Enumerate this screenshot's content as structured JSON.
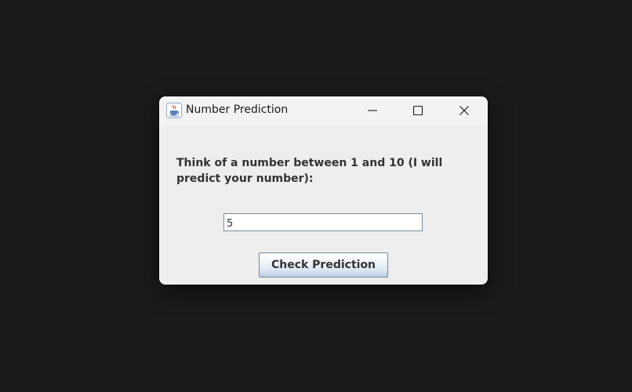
{
  "window": {
    "title": "Number Prediction",
    "icon": "java-cup-icon",
    "controls": [
      "minimize-icon",
      "maximize-icon",
      "close-icon"
    ]
  },
  "form": {
    "prompt": "Think of a number between 1 and 10 (I will predict your number):",
    "input_value": "5",
    "button_label": "Check Prediction"
  },
  "colors": {
    "desktop": "#1a1a1a",
    "window_bg": "#eeeeee",
    "titlebar_bg": "#f3f3f3",
    "text": "#333333",
    "button_gradient_bottom": "#b9cde3"
  }
}
